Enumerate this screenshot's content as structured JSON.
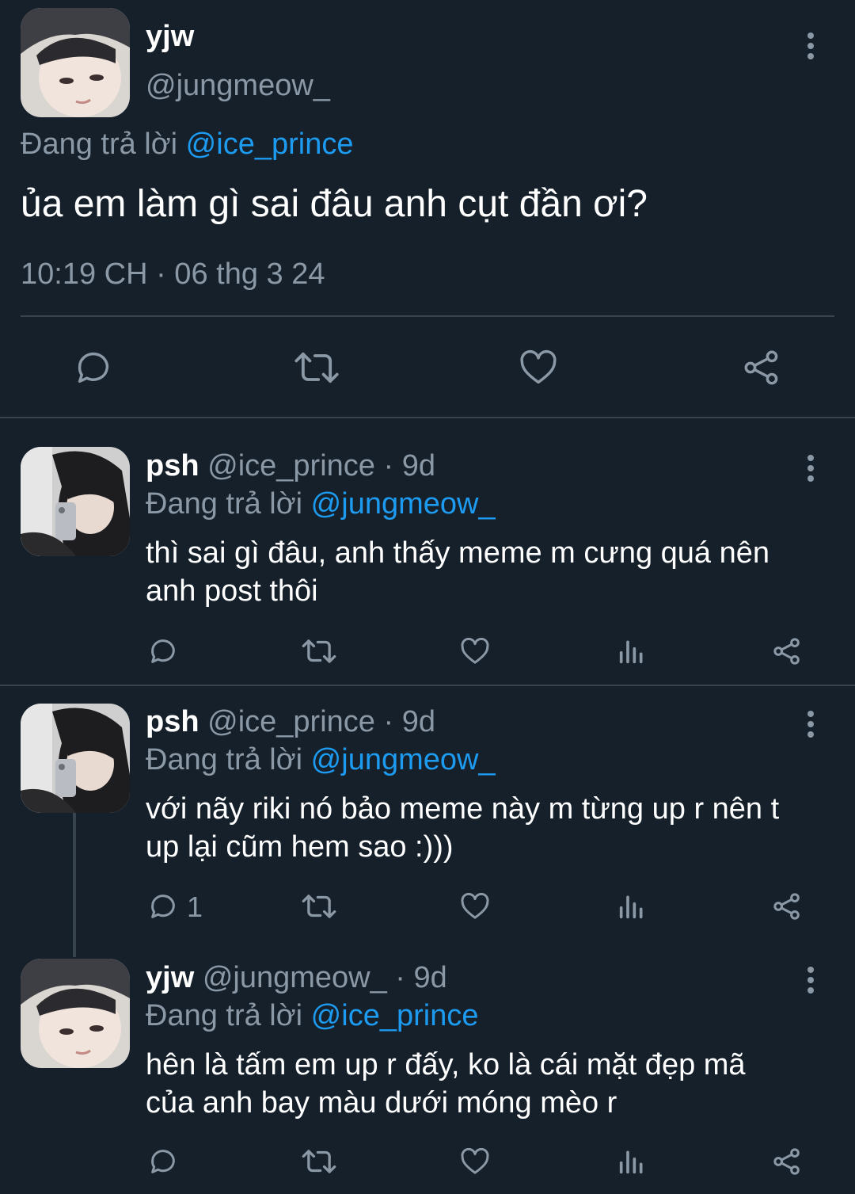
{
  "main_tweet": {
    "name": "yjw",
    "handle": "@jungmeow_",
    "replying_prefix": "Đang trả lời",
    "replying_to": "@ice_prince",
    "text": "ủa em làm gì sai đâu anh cụt đần ơi?",
    "timestamp": "10:19 CH · 06 thg 3 24"
  },
  "replies": [
    {
      "name": "psh",
      "handle": "@ice_prince",
      "time": "· 9d",
      "replying_prefix": "Đang trả lời",
      "replying_to": "@jungmeow_",
      "text_line1": "thì sai gì đâu, anh thấy meme m cưng quá nên",
      "text_line2": "anh post thôi",
      "reply_count": ""
    },
    {
      "name": "psh",
      "handle": "@ice_prince",
      "time": "· 9d",
      "replying_prefix": "Đang trả lời",
      "replying_to": "@jungmeow_",
      "text_line1": "với nãy riki nó bảo meme này m từng up r nên t",
      "text_line2": "up lại cũm hem sao :)))",
      "reply_count": "1"
    },
    {
      "name": "yjw",
      "handle": "@jungmeow_",
      "time": "· 9d",
      "replying_prefix": "Đang trả lời",
      "replying_to": "@ice_prince",
      "text_line1": "hên là tấm em up r đấy, ko là cái mặt đẹp mã",
      "text_line2": "của anh bay màu dưới móng mèo r",
      "reply_count": ""
    }
  ],
  "icons": [
    "reply-icon",
    "retweet-icon",
    "like-icon",
    "views-icon",
    "share-icon",
    "more-options-icon"
  ],
  "colors": {
    "background": "#15202b",
    "accent": "#1d9bf0",
    "muted": "#8b98a5",
    "divider": "#38444d"
  }
}
